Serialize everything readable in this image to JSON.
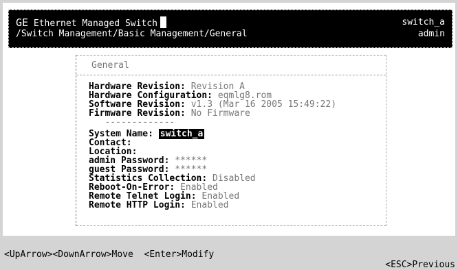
{
  "header": {
    "title_prefix": "GE",
    "title_rest": " Ethernet Managed Switch",
    "path": "/Switch Management/Basic Management/General",
    "system": "switch_a",
    "user": "admin"
  },
  "panel": {
    "title": "General",
    "separator": "-------------",
    "hardware_fields": [
      {
        "label": "Hardware Revision:",
        "value": "Revision A"
      },
      {
        "label": "Hardware Configuration:",
        "value": "eqmlg8.rom"
      },
      {
        "label": "Software Revision:",
        "value": "v1.3 (Mar 16 2005 15:49:22)"
      },
      {
        "label": "Firmware Revision:",
        "value": "No Firmware"
      }
    ],
    "system_name": {
      "label": "System Name:",
      "value": "switch_a"
    },
    "config_fields": [
      {
        "label": "Contact:",
        "value": ""
      },
      {
        "label": "Location:",
        "value": ""
      },
      {
        "label": "admin Password:",
        "value": "******"
      },
      {
        "label": "guest Password:",
        "value": "******"
      },
      {
        "label": "Statistics Collection:",
        "value": "Disabled"
      },
      {
        "label": "Reboot-On-Error:",
        "value": "Enabled"
      },
      {
        "label": "Remote Telnet Login:",
        "value": "Enabled"
      },
      {
        "label": "Remote HTTP Login:",
        "value": "Enabled"
      }
    ]
  },
  "footer": {
    "nav_hint": "<UpArrow><DownArrow>Move  <Enter>Modify",
    "esc_hint": "<ESC>Previous"
  }
}
